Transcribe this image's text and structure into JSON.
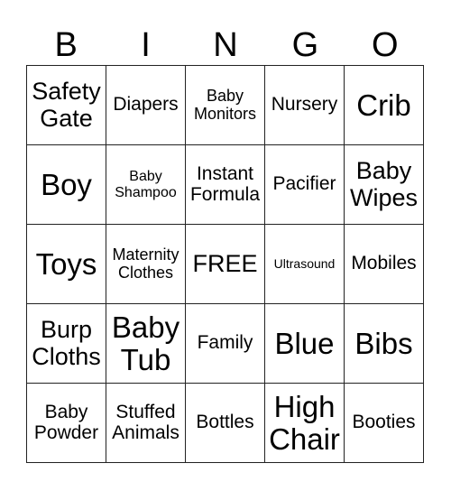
{
  "header": [
    "B",
    "I",
    "N",
    "G",
    "O"
  ],
  "rows": [
    [
      "Safety Gate",
      "Diapers",
      "Baby Monitors",
      "Nursery",
      "Crib"
    ],
    [
      "Boy",
      "Baby Shampoo",
      "Instant Formula",
      "Pacifier",
      "Baby Wipes"
    ],
    [
      "Toys",
      "Maternity Clothes",
      "FREE",
      "Ultrasound",
      "Mobiles"
    ],
    [
      "Burp Cloths",
      "Baby Tub",
      "Family",
      "Blue",
      "Bibs"
    ],
    [
      "Baby Powder",
      "Stuffed Animals",
      "Bottles",
      "High Chair",
      "Booties"
    ]
  ]
}
